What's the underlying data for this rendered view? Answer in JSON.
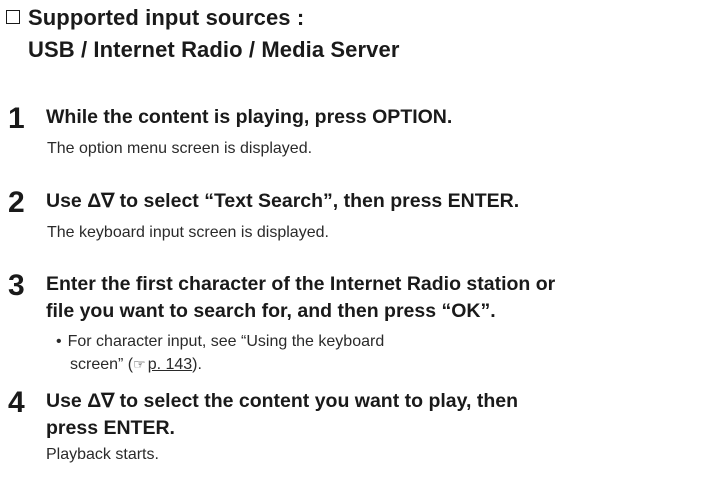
{
  "heading": {
    "line1": "Supported input sources :",
    "line2": "USB / Internet Radio / Media Server"
  },
  "steps": [
    {
      "number": "1",
      "title": "While the content is playing, press OPTION.",
      "description": "The option menu screen is displayed."
    },
    {
      "number": "2",
      "title": "Use Δ∇ to select “Text Search”, then press ENTER.",
      "description": "The keyboard input screen is displayed."
    },
    {
      "number": "3",
      "title_line1": "Enter the first character of the Internet Radio station or",
      "title_line2": "file you want to search for, and then press “OK”.",
      "bullet_line1": "For character input, see “Using the keyboard",
      "bullet_line2_prefix": "screen” (",
      "bullet_link": "p. 143",
      "bullet_line2_suffix": ")."
    },
    {
      "number": "4",
      "title_line1": "Use Δ∇ to select the content you want to play, then",
      "title_line2": "press ENTER.",
      "description": "Playback starts."
    }
  ],
  "icons": {
    "checkbox": "checkbox-icon",
    "reference": "hand-pointer-icon"
  }
}
